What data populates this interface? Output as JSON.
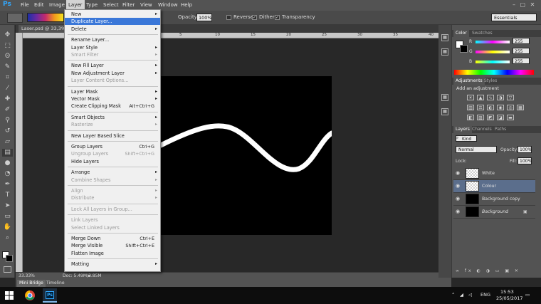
{
  "app": {
    "logo": "Ps"
  },
  "menubar": {
    "items": [
      "File",
      "Edit",
      "Image",
      "Layer",
      "Type",
      "Select",
      "Filter",
      "View",
      "Window",
      "Help"
    ],
    "active": "Layer"
  },
  "options": {
    "opacity_label": "Opacity:",
    "opacity_value": "100%",
    "reverse_label": "Reverse",
    "dither_label": "Dither",
    "transparency_label": "Transparency",
    "reverse_checked": false,
    "dither_checked": true,
    "transparency_checked": true,
    "workspace": "Essentials"
  },
  "document": {
    "tab_title": "Laser.psd @ 33,3% (C",
    "ruler_ticks": [
      "5",
      "10",
      "15",
      "20",
      "25",
      "30",
      "35",
      "40"
    ],
    "zoom": "33.33%",
    "doc_size": "Doc: 5.49M/3.85M"
  },
  "bottom_tabs": [
    "Mini Bridge",
    "Timeline"
  ],
  "layer_menu": {
    "items": [
      {
        "label": "New",
        "submenu": true
      },
      {
        "label": "Duplicate Layer...",
        "highlight": true
      },
      {
        "label": "Delete",
        "submenu": true
      },
      {
        "sep": true
      },
      {
        "label": "Rename Layer..."
      },
      {
        "label": "Layer Style",
        "submenu": true
      },
      {
        "label": "Smart Filter",
        "disabled": true,
        "submenu": true
      },
      {
        "sep": true
      },
      {
        "label": "New Fill Layer",
        "submenu": true
      },
      {
        "label": "New Adjustment Layer",
        "submenu": true
      },
      {
        "label": "Layer Content Options...",
        "disabled": true
      },
      {
        "sep": true
      },
      {
        "label": "Layer Mask",
        "submenu": true
      },
      {
        "label": "Vector Mask",
        "submenu": true
      },
      {
        "label": "Create Clipping Mask",
        "shortcut": "Alt+Ctrl+G"
      },
      {
        "sep": true
      },
      {
        "label": "Smart Objects",
        "submenu": true
      },
      {
        "label": "Rasterize",
        "disabled": true,
        "submenu": true
      },
      {
        "sep": true
      },
      {
        "label": "New Layer Based Slice"
      },
      {
        "sep": true
      },
      {
        "label": "Group Layers",
        "shortcut": "Ctrl+G"
      },
      {
        "label": "Ungroup Layers",
        "disabled": true,
        "shortcut": "Shift+Ctrl+G"
      },
      {
        "label": "Hide Layers"
      },
      {
        "sep": true
      },
      {
        "label": "Arrange",
        "submenu": true
      },
      {
        "label": "Combine Shapes",
        "disabled": true,
        "submenu": true
      },
      {
        "sep": true
      },
      {
        "label": "Align",
        "disabled": true,
        "submenu": true
      },
      {
        "label": "Distribute",
        "disabled": true,
        "submenu": true
      },
      {
        "sep": true
      },
      {
        "label": "Lock All Layers in Group...",
        "disabled": true
      },
      {
        "sep": true
      },
      {
        "label": "Link Layers",
        "disabled": true
      },
      {
        "label": "Select Linked Layers",
        "disabled": true
      },
      {
        "sep": true
      },
      {
        "label": "Merge Down",
        "shortcut": "Ctrl+E"
      },
      {
        "label": "Merge Visible",
        "shortcut": "Shift+Ctrl+E"
      },
      {
        "label": "Flatten Image"
      },
      {
        "sep": true
      },
      {
        "label": "Matting",
        "submenu": true
      }
    ]
  },
  "color_panel": {
    "tabs": [
      "Color",
      "Swatches"
    ],
    "channels": [
      {
        "name": "R",
        "value": "255"
      },
      {
        "name": "G",
        "value": "255"
      },
      {
        "name": "B",
        "value": "255"
      }
    ]
  },
  "adjustments_panel": {
    "tabs": [
      "Adjustments",
      "Styles"
    ],
    "heading": "Add an adjustment"
  },
  "layers_panel": {
    "tabs": [
      "Layers",
      "Channels",
      "Paths"
    ],
    "kind_label": "Kind",
    "blend_mode": "Normal",
    "opacity_label": "Opacity:",
    "opacity_value": "100%",
    "lock_label": "Lock:",
    "fill_label": "Fill:",
    "fill_value": "100%",
    "layers": [
      {
        "name": "White",
        "thumb": "checker",
        "selected": false,
        "italic": false
      },
      {
        "name": "Colour",
        "thumb": "checker",
        "selected": true,
        "italic": false
      },
      {
        "name": "Background copy",
        "thumb": "black",
        "selected": false,
        "italic": false
      },
      {
        "name": "Background",
        "thumb": "black",
        "selected": false,
        "italic": true,
        "locked": true
      }
    ]
  },
  "taskbar": {
    "language": "ENG",
    "time": "15:53",
    "date": "25/05/2017"
  },
  "colors": {
    "menu_highlight": "#3a77d8",
    "layer_selected": "#5b6e8c",
    "ps_blue": "#31a8ff"
  }
}
